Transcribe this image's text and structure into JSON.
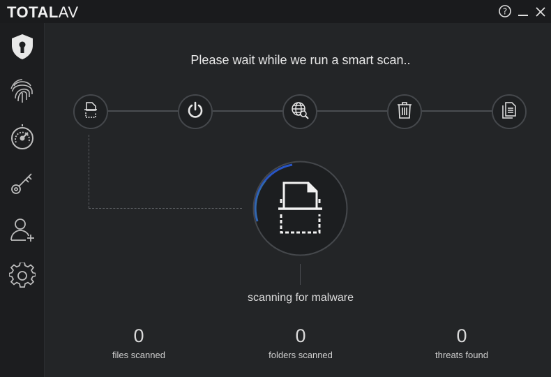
{
  "app": {
    "brand_bold": "TOTAL",
    "brand_light": "AV"
  },
  "window_controls": [
    "help-icon",
    "minimize-icon",
    "close-icon"
  ],
  "sidebar": {
    "items": [
      {
        "icon": "shield-lock-icon",
        "active": true
      },
      {
        "icon": "fingerprint-icon"
      },
      {
        "icon": "speedometer-icon"
      },
      {
        "icon": "key-icon"
      },
      {
        "icon": "add-user-icon"
      },
      {
        "icon": "gear-icon"
      }
    ]
  },
  "scan": {
    "heading": "Please wait while we run a smart scan..",
    "steps": [
      "file-scan-icon",
      "power-icon",
      "globe-search-icon",
      "trash-icon",
      "documents-icon"
    ],
    "status": "scanning for malware",
    "progress_arc_color": "#2a5bd7"
  },
  "stats": [
    {
      "value": "0",
      "label": "files scanned"
    },
    {
      "value": "0",
      "label": "folders scanned"
    },
    {
      "value": "0",
      "label": "threats found"
    }
  ]
}
